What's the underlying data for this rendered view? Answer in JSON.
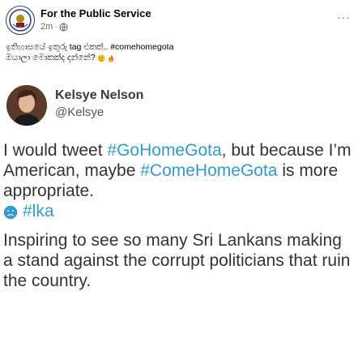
{
  "post": {
    "page_name": "For the Public Service",
    "time": "2m",
    "separator": "·",
    "more_label": "···",
    "caption_line1": "ඉතිහාසයේ ඉතුරු tag එකක්.. #comehomegota",
    "caption_line2": "ඔයාලා මොකක්ද දන්නේ?"
  },
  "tweet": {
    "name": "Kelsye Nelson",
    "handle": "@Kelsye",
    "text_part1": "I would tweet ",
    "hashtag1": "#GoHomeGota",
    "text_part2": ", but because I’m American, maybe ",
    "hashtag2": "#ComeHomeGota",
    "text_part3": " is more appropriate.",
    "tag": "#lka",
    "comment": "Inspiring to see so many Sri Lankans making a stand against the corrupt politicians that ruin the country."
  },
  "icons": {
    "page_avatar": "coat-of-arms-icon",
    "globe": "globe-icon",
    "emoji_thinking": "thinking-face-icon",
    "emoji_fire": "fire-icon",
    "tag_emoji": "frowning-face-icon"
  },
  "colors": {
    "hashtag": "#2f9ad6",
    "tweet_text": "#333333",
    "meta_gray": "#65676b"
  }
}
